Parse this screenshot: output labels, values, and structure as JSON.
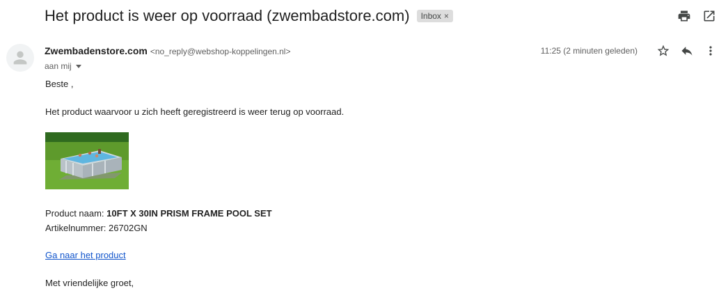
{
  "email": {
    "subject": "Het product is weer op voorraad (zwembadstore.com)",
    "label": "Inbox",
    "label_remove": "×",
    "sender_name": "Zwembadenstore.com",
    "sender_email": "<no_reply@webshop-koppelingen.nl>",
    "recipient": "aan mij",
    "timestamp": "11:25 (2 minuten geleden)"
  },
  "body": {
    "greeting": "Beste ,",
    "intro": "Het product waarvoor u zich heeft geregistreerd is weer terug op voorraad.",
    "product_name_label": "Product naam:",
    "product_name": "10FT X 30IN PRISM FRAME POOL SET",
    "article_label": "Artikelnummer:",
    "article_number": "26702GN",
    "link_text": "Ga naar het product",
    "closing": "Met vriendelijke groet,"
  },
  "icons": {
    "print": "print-icon",
    "open_new_window": "open-in-new-window-icon",
    "star": "star-icon",
    "reply": "reply-icon",
    "more": "more-vert-icon",
    "avatar": "avatar-person-icon"
  },
  "colors": {
    "link": "#1155cc",
    "label_chip_bg": "#dddddd",
    "text": "#222222",
    "muted": "#5e5e5e"
  }
}
